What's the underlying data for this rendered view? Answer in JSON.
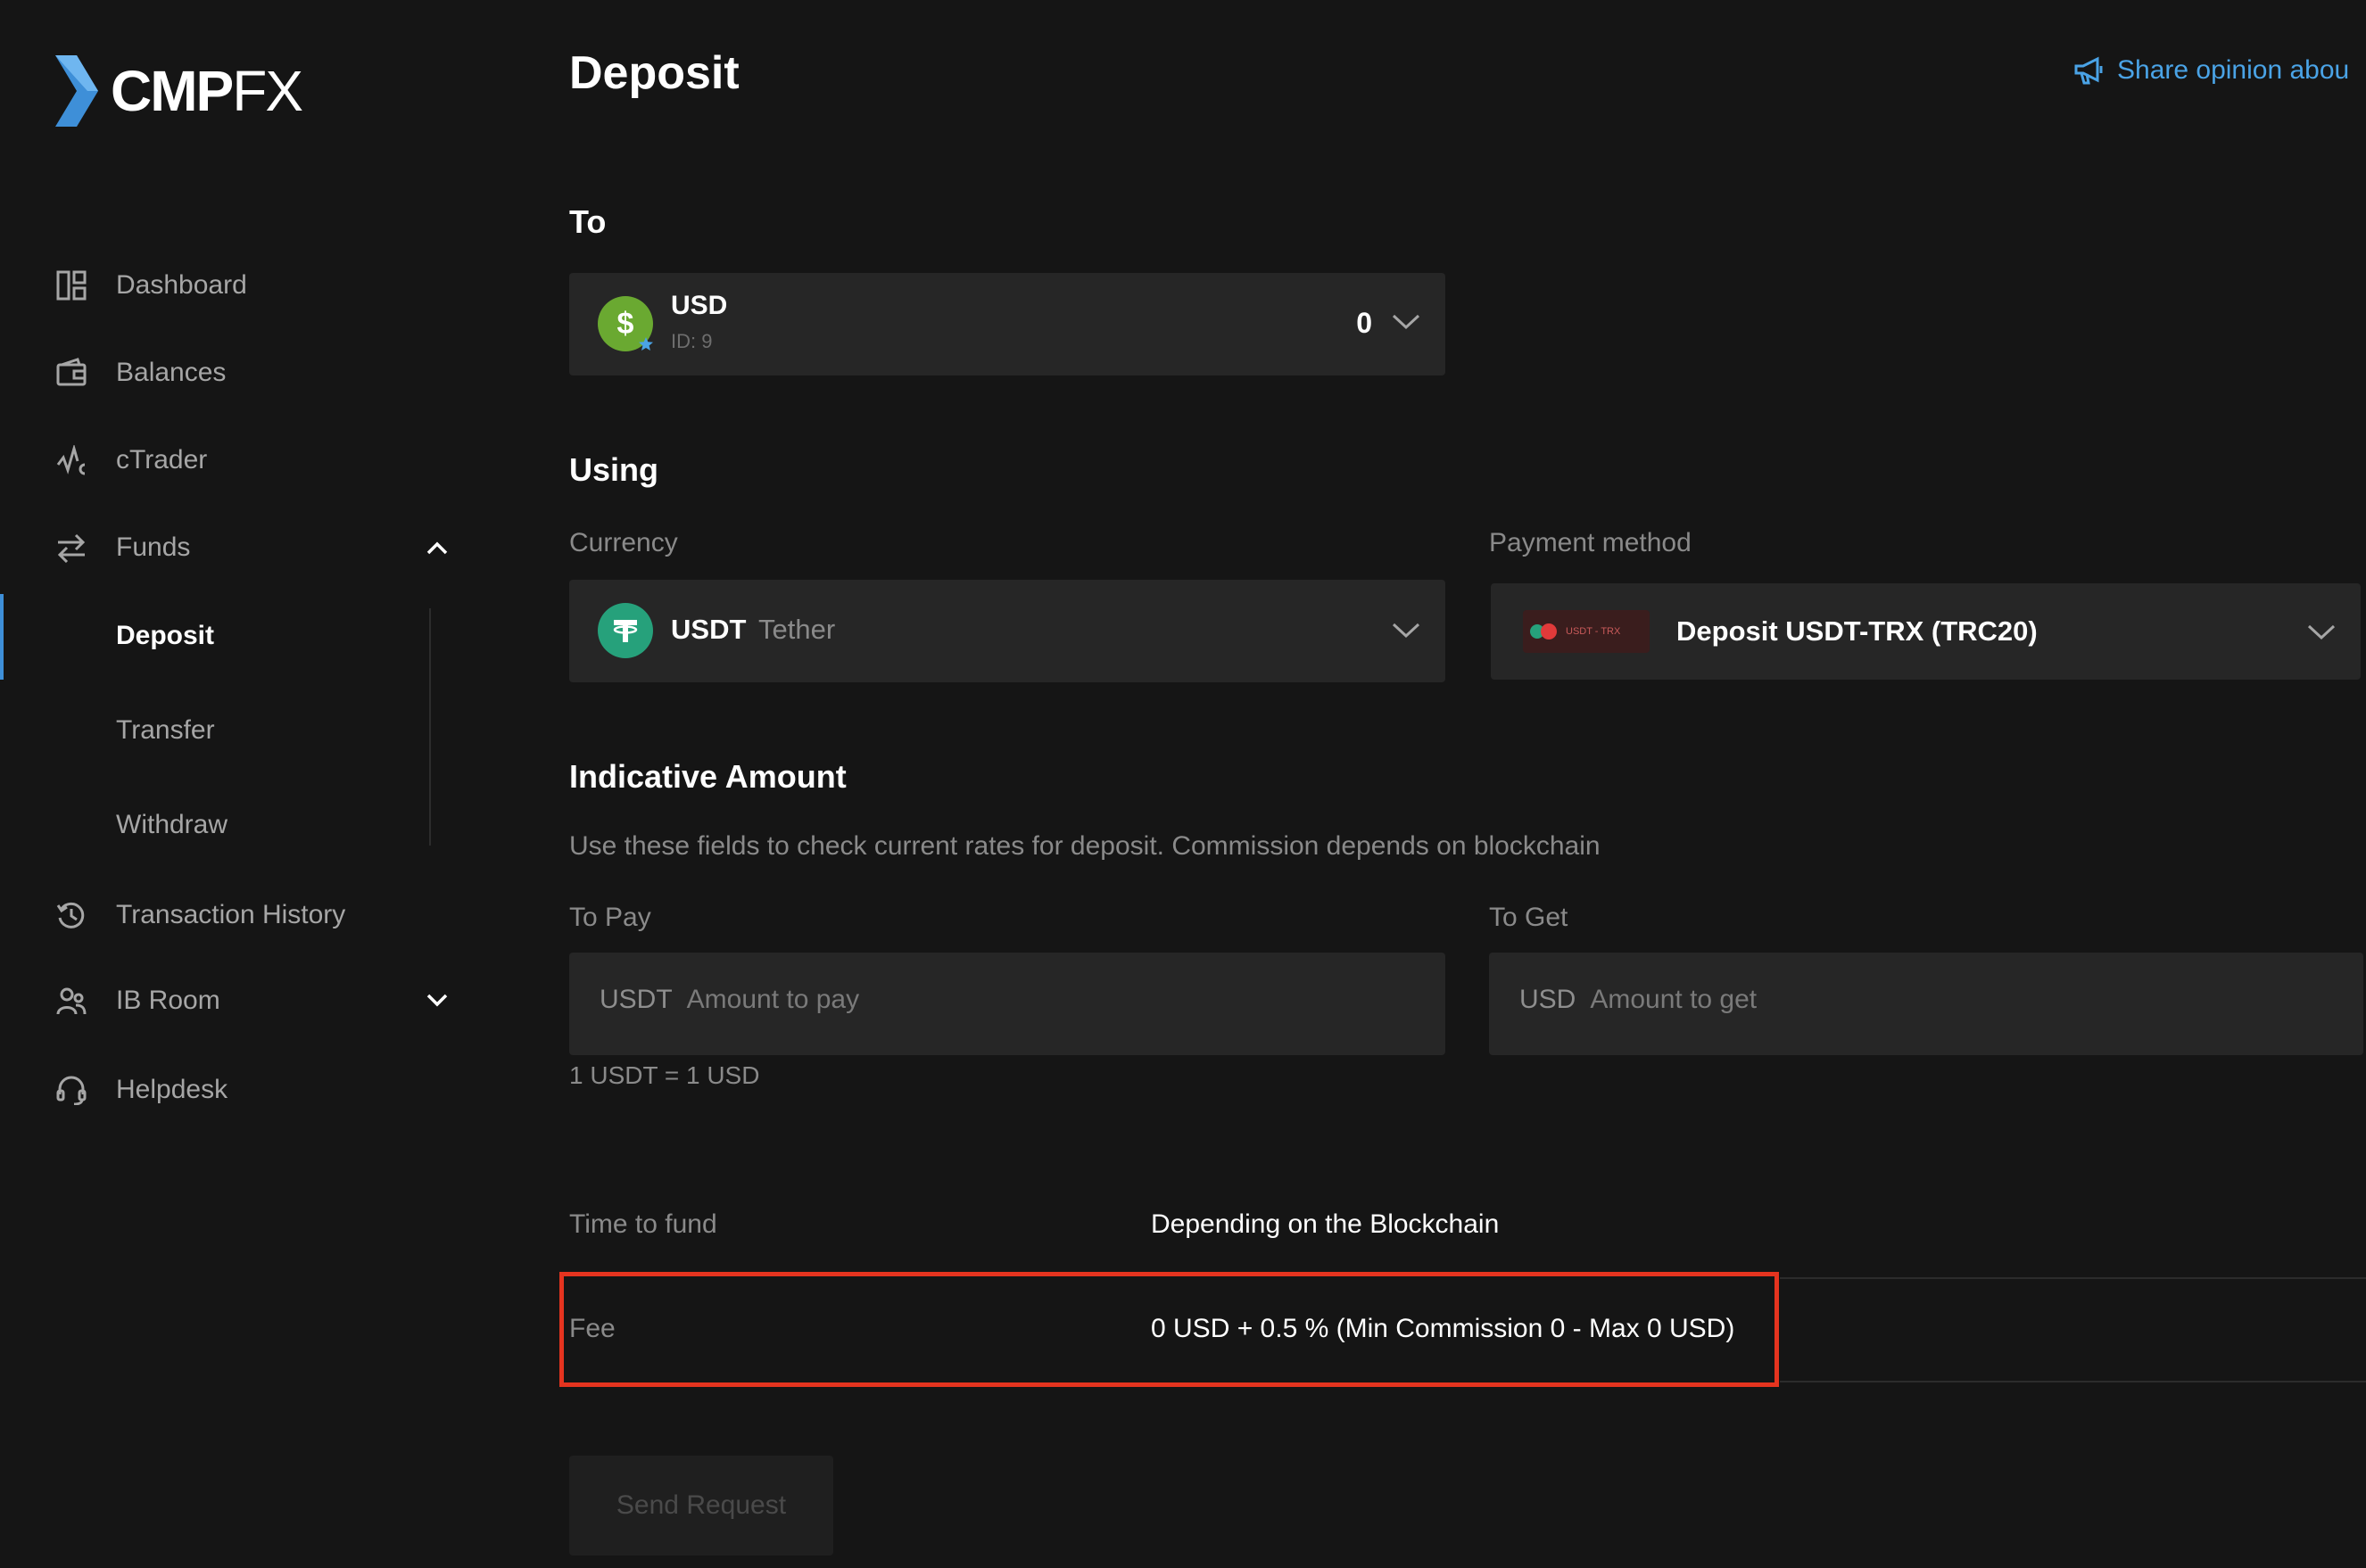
{
  "brand": {
    "name_main": "CMP",
    "name_fx": "FX"
  },
  "sidebar": {
    "items": [
      {
        "label": "Dashboard",
        "icon": "dashboard-icon"
      },
      {
        "label": "Balances",
        "icon": "wallet-icon"
      },
      {
        "label": "cTrader",
        "icon": "ctrader-icon"
      },
      {
        "label": "Funds",
        "icon": "transfer-arrows-icon",
        "expanded": true
      },
      {
        "label": "Transaction History",
        "icon": "history-icon"
      },
      {
        "label": "IB Room",
        "icon": "users-icon",
        "expanded": false
      },
      {
        "label": "Helpdesk",
        "icon": "headset-icon"
      }
    ],
    "funds_sub": [
      "Deposit",
      "Transfer",
      "Withdraw"
    ],
    "active_sub": "Deposit"
  },
  "page": {
    "title": "Deposit",
    "share_label": "Share opinion abou"
  },
  "to_section": {
    "heading": "To",
    "account_currency": "USD",
    "account_id": "ID: 9",
    "balance": "0"
  },
  "using_section": {
    "heading": "Using",
    "currency_label": "Currency",
    "currency_code": "USDT",
    "currency_name": "Tether",
    "payment_label": "Payment method",
    "payment_badge": "USDT - TRX",
    "payment_value": "Deposit USDT-TRX (TRC20)"
  },
  "amount_section": {
    "heading": "Indicative Amount",
    "description": "Use these fields to check current rates for deposit. Commission depends on blockchain",
    "pay_label": "To Pay",
    "pay_prefix": "USDT",
    "pay_placeholder": "Amount to pay",
    "get_label": "To Get",
    "get_prefix": "USD",
    "get_placeholder": "Amount to get",
    "rate": "1 USDT = 1 USD"
  },
  "info": {
    "time_label": "Time to fund",
    "time_value": "Depending on the Blockchain",
    "fee_label": "Fee",
    "fee_value": "0 USD + 0.5 % (Min Commission 0 - Max 0 USD)"
  },
  "send_label": "Send Request",
  "colors": {
    "background": "#151515",
    "panel": "#262626",
    "accent": "#4aa3e6",
    "usd_coin": "#6aa931",
    "usdt_coin": "#26a17b",
    "highlight": "#e5341f"
  }
}
